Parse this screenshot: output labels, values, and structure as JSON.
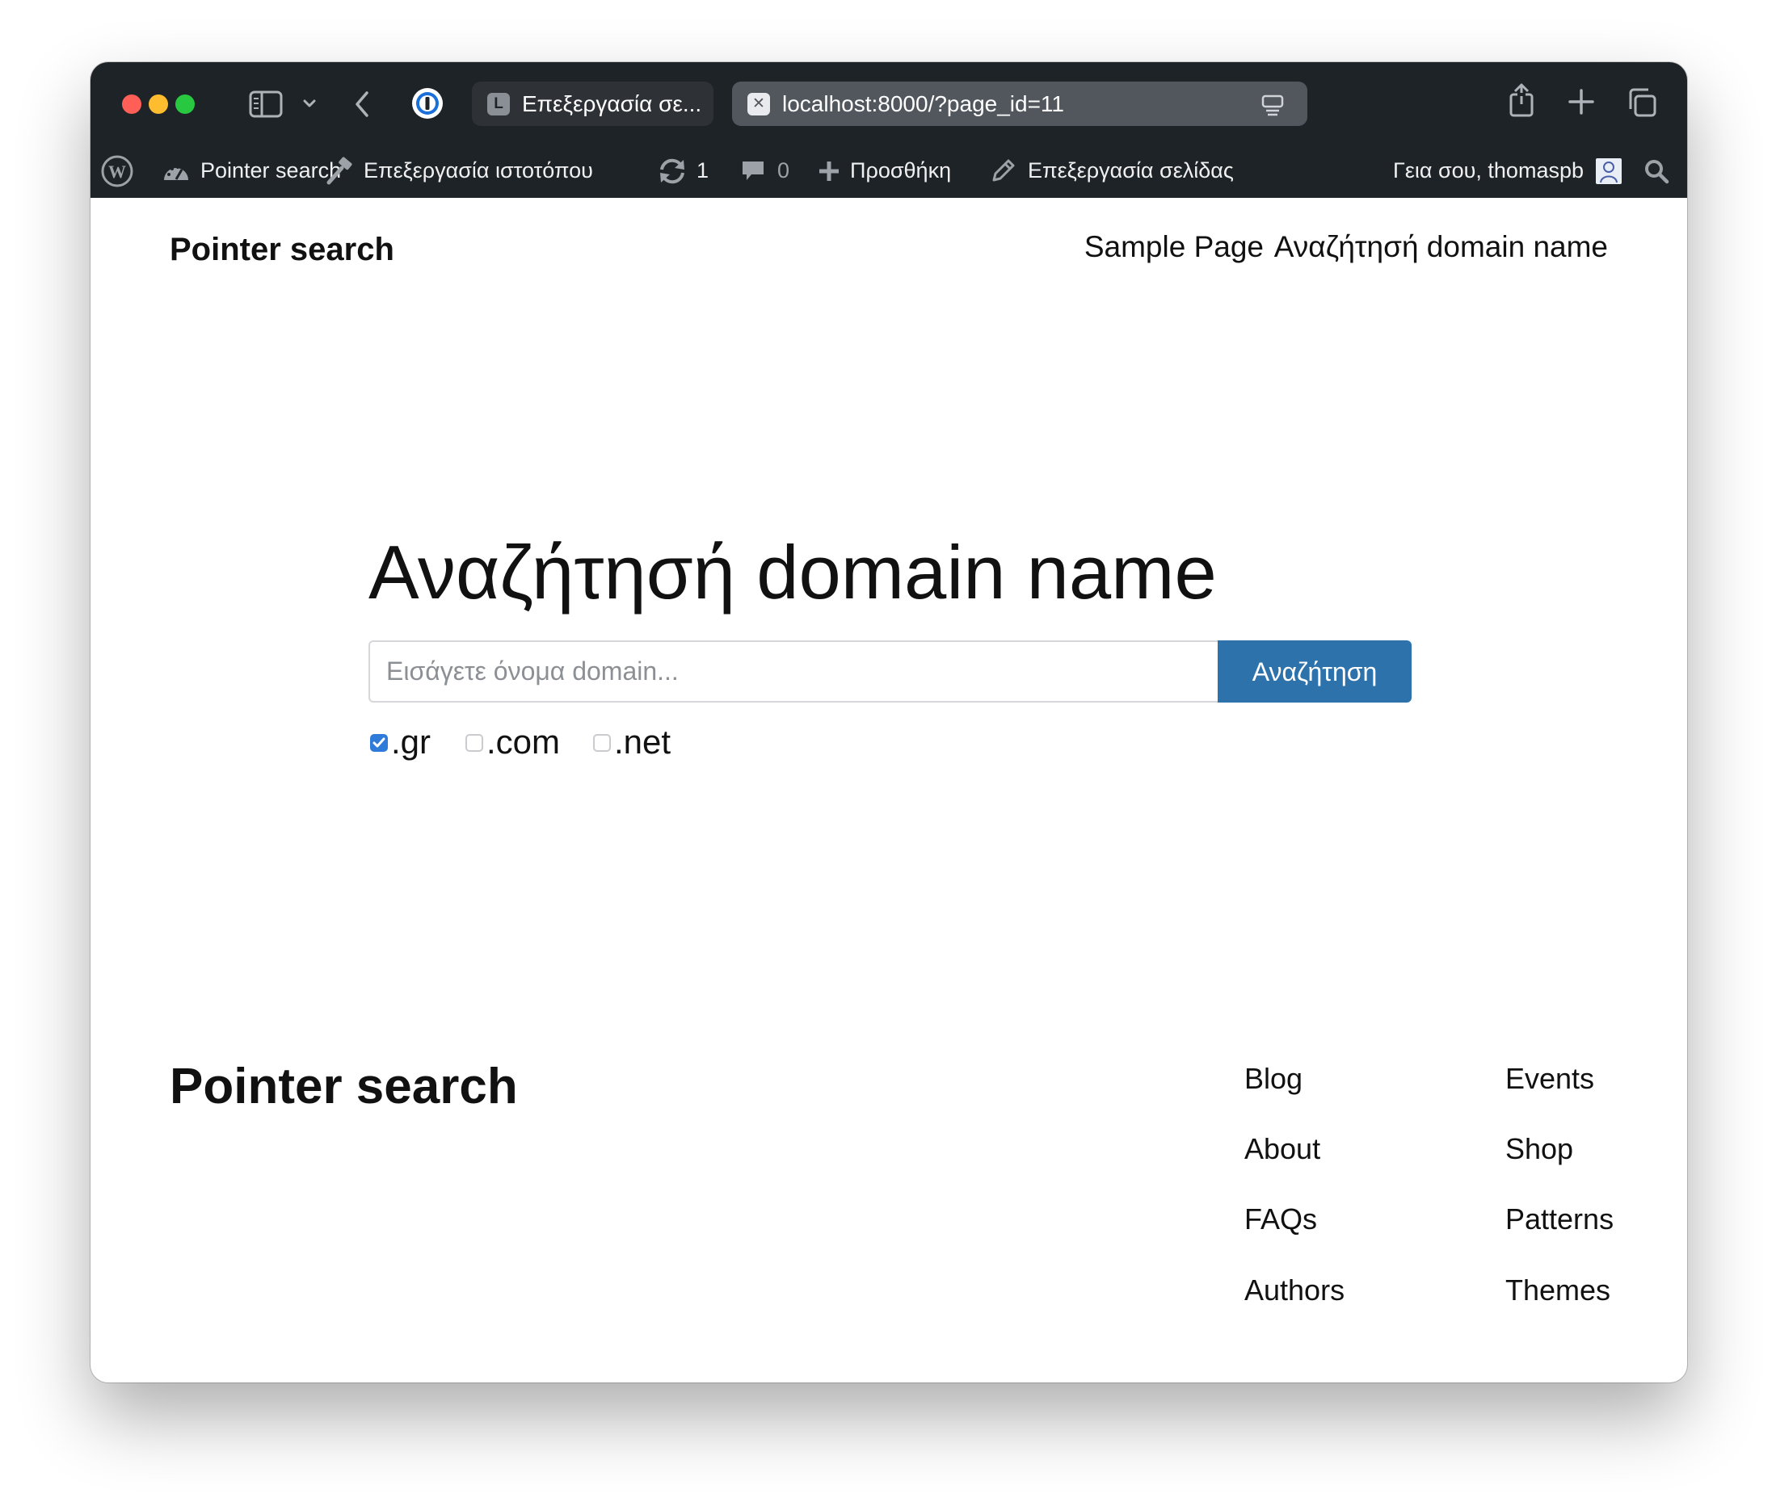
{
  "browser": {
    "tabs": [
      {
        "favicon": "L",
        "title": "Επεξεργασία σε...",
        "active": false
      },
      {
        "favicon": "close-tab-icon",
        "title": "localhost:8000/?page_id=11",
        "active": true
      }
    ],
    "traffic_lights": [
      "#ff5f57",
      "#febc2e",
      "#28c840"
    ]
  },
  "admin_bar": {
    "site_name": "Pointer search",
    "customize": "Επεξεργασία ιστοτόπου",
    "updates_count": "1",
    "comments_count": "0",
    "new_label": "Προσθήκη",
    "edit_page": "Επεξεργασία σελίδας",
    "greeting": "Γεια σου, thomaspb"
  },
  "header": {
    "site_title": "Pointer search",
    "nav": [
      "Sample Page",
      "Αναζήτησή domain name"
    ]
  },
  "main": {
    "title": "Αναζήτησή domain name",
    "search_placeholder": "Εισάγετε όνομα domain...",
    "search_value": "",
    "search_button": "Αναζήτηση",
    "tlds": [
      {
        "label": ".gr",
        "checked": true
      },
      {
        "label": ".com",
        "checked": false
      },
      {
        "label": ".net",
        "checked": false
      }
    ]
  },
  "footer": {
    "title": "Pointer search",
    "links_col1": [
      "Blog",
      "About",
      "FAQs",
      "Authors"
    ],
    "links_col2": [
      "Events",
      "Shop",
      "Patterns",
      "Themes"
    ]
  },
  "colors": {
    "titlebar": "#1e2328",
    "admin_bar": "#1d2327",
    "accent_button": "#2e72ac",
    "checkbox_checked": "#2f7bd9"
  }
}
